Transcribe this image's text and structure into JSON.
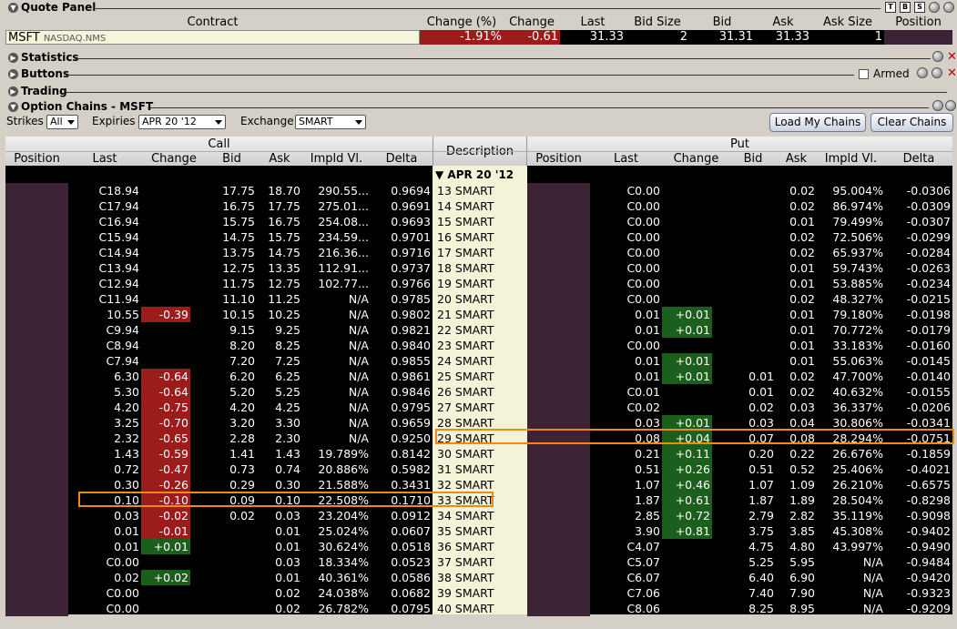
{
  "quote_panel": {
    "title": "Quote Panel",
    "buttons": [
      "T",
      "B",
      "S"
    ],
    "columns": [
      "Contract",
      "Change (%)",
      "Change",
      "Last",
      "Bid Size",
      "Bid",
      "Ask",
      "Ask Size",
      "Position"
    ],
    "row": {
      "symbol": "MSFT",
      "exchange": "NASDAQ.NMS",
      "change_pct": "-1.91%",
      "change": "-0.61",
      "last": "31.33",
      "bid_size": "2",
      "bid": "31.31",
      "ask": "31.33",
      "ask_size": "1",
      "position": ""
    }
  },
  "sections": {
    "statistics": "Statistics",
    "buttons": "Buttons",
    "armed": "Armed",
    "trading": "Trading",
    "option_chains": "Option Chains - MSFT"
  },
  "controls": {
    "strikes_label": "Strikes",
    "strikes_value": "All",
    "expiries_label": "Expiries",
    "expiries_value": "APR 20 '12",
    "exchange_label": "Exchange",
    "exchange_value": "SMART",
    "load_btn": "Load My Chains",
    "clear_btn": "Clear Chains"
  },
  "table": {
    "call_label": "Call",
    "put_label": "Put",
    "description_label": "Description",
    "call_columns": [
      "Position",
      "Last",
      "Change",
      "Bid",
      "Ask",
      "Impld Vl.",
      "Delta"
    ],
    "put_columns": [
      "Position",
      "Last",
      "Change",
      "Bid",
      "Ask",
      "Impld Vl.",
      "Delta"
    ],
    "expiry_group": "APR 20 '12",
    "rows": [
      {
        "desc": "13 SMART",
        "c_last": "C18.94",
        "c_chg": "",
        "c_bid": "17.75",
        "c_ask": "18.70",
        "c_iv": "290.55...",
        "c_delta": "0.9694",
        "p_last": "C0.00",
        "p_chg": "",
        "p_bid": "",
        "p_ask": "0.02",
        "p_iv": "95.004%",
        "p_delta": "-0.0306"
      },
      {
        "desc": "14 SMART",
        "c_last": "C17.94",
        "c_chg": "",
        "c_bid": "16.75",
        "c_ask": "17.75",
        "c_iv": "275.01...",
        "c_delta": "0.9691",
        "p_last": "C0.00",
        "p_chg": "",
        "p_bid": "",
        "p_ask": "0.02",
        "p_iv": "86.974%",
        "p_delta": "-0.0309"
      },
      {
        "desc": "15 SMART",
        "c_last": "C16.94",
        "c_chg": "",
        "c_bid": "15.75",
        "c_ask": "16.75",
        "c_iv": "254.08...",
        "c_delta": "0.9693",
        "p_last": "C0.00",
        "p_chg": "",
        "p_bid": "",
        "p_ask": "0.01",
        "p_iv": "79.499%",
        "p_delta": "-0.0307"
      },
      {
        "desc": "16 SMART",
        "c_last": "C15.94",
        "c_chg": "",
        "c_bid": "14.75",
        "c_ask": "15.75",
        "c_iv": "234.59...",
        "c_delta": "0.9701",
        "p_last": "C0.00",
        "p_chg": "",
        "p_bid": "",
        "p_ask": "0.02",
        "p_iv": "72.506%",
        "p_delta": "-0.0299"
      },
      {
        "desc": "17 SMART",
        "c_last": "C14.94",
        "c_chg": "",
        "c_bid": "13.75",
        "c_ask": "14.75",
        "c_iv": "216.36...",
        "c_delta": "0.9716",
        "p_last": "C0.00",
        "p_chg": "",
        "p_bid": "",
        "p_ask": "0.02",
        "p_iv": "65.937%",
        "p_delta": "-0.0284"
      },
      {
        "desc": "18 SMART",
        "c_last": "C13.94",
        "c_chg": "",
        "c_bid": "12.75",
        "c_ask": "13.35",
        "c_iv": "112.91...",
        "c_delta": "0.9737",
        "p_last": "C0.00",
        "p_chg": "",
        "p_bid": "",
        "p_ask": "0.01",
        "p_iv": "59.743%",
        "p_delta": "-0.0263"
      },
      {
        "desc": "19 SMART",
        "c_last": "C12.94",
        "c_chg": "",
        "c_bid": "11.75",
        "c_ask": "12.75",
        "c_iv": "102.77...",
        "c_delta": "0.9766",
        "p_last": "C0.00",
        "p_chg": "",
        "p_bid": "",
        "p_ask": "0.01",
        "p_iv": "53.885%",
        "p_delta": "-0.0234"
      },
      {
        "desc": "20 SMART",
        "c_last": "C11.94",
        "c_chg": "",
        "c_bid": "11.10",
        "c_ask": "11.25",
        "c_iv": "N/A",
        "c_delta": "0.9785",
        "p_last": "C0.00",
        "p_chg": "",
        "p_bid": "",
        "p_ask": "0.02",
        "p_iv": "48.327%",
        "p_delta": "-0.0215"
      },
      {
        "desc": "21 SMART",
        "c_last": "10.55",
        "c_chg": "-0.39",
        "c_bid": "10.15",
        "c_ask": "10.25",
        "c_iv": "N/A",
        "c_delta": "0.9802",
        "p_last": "0.01",
        "p_chg": "+0.01",
        "p_bid": "",
        "p_ask": "0.01",
        "p_iv": "79.180%",
        "p_delta": "-0.0198"
      },
      {
        "desc": "22 SMART",
        "c_last": "C9.94",
        "c_chg": "",
        "c_bid": "9.15",
        "c_ask": "9.25",
        "c_iv": "N/A",
        "c_delta": "0.9821",
        "p_last": "0.01",
        "p_chg": "+0.01",
        "p_bid": "",
        "p_ask": "0.01",
        "p_iv": "70.772%",
        "p_delta": "-0.0179"
      },
      {
        "desc": "23 SMART",
        "c_last": "C8.94",
        "c_chg": "",
        "c_bid": "8.20",
        "c_ask": "8.25",
        "c_iv": "N/A",
        "c_delta": "0.9840",
        "p_last": "C0.00",
        "p_chg": "",
        "p_bid": "",
        "p_ask": "0.01",
        "p_iv": "33.183%",
        "p_delta": "-0.0160"
      },
      {
        "desc": "24 SMART",
        "c_last": "C7.94",
        "c_chg": "",
        "c_bid": "7.20",
        "c_ask": "7.25",
        "c_iv": "N/A",
        "c_delta": "0.9855",
        "p_last": "0.01",
        "p_chg": "+0.01",
        "p_bid": "",
        "p_ask": "0.01",
        "p_iv": "55.063%",
        "p_delta": "-0.0145"
      },
      {
        "desc": "25 SMART",
        "c_last": "6.30",
        "c_chg": "-0.64",
        "c_bid": "6.20",
        "c_ask": "6.25",
        "c_iv": "N/A",
        "c_delta": "0.9861",
        "p_last": "0.01",
        "p_chg": "+0.01",
        "p_bid": "0.01",
        "p_ask": "0.02",
        "p_iv": "47.700%",
        "p_delta": "-0.0140"
      },
      {
        "desc": "26 SMART",
        "c_last": "5.30",
        "c_chg": "-0.64",
        "c_bid": "5.20",
        "c_ask": "5.25",
        "c_iv": "N/A",
        "c_delta": "0.9846",
        "p_last": "C0.01",
        "p_chg": "",
        "p_bid": "0.01",
        "p_ask": "0.02",
        "p_iv": "40.632%",
        "p_delta": "-0.0155"
      },
      {
        "desc": "27 SMART",
        "c_last": "4.20",
        "c_chg": "-0.75",
        "c_bid": "4.20",
        "c_ask": "4.25",
        "c_iv": "N/A",
        "c_delta": "0.9795",
        "p_last": "C0.02",
        "p_chg": "",
        "p_bid": "0.02",
        "p_ask": "0.03",
        "p_iv": "36.337%",
        "p_delta": "-0.0206"
      },
      {
        "desc": "28 SMART",
        "c_last": "3.25",
        "c_chg": "-0.70",
        "c_bid": "3.20",
        "c_ask": "3.30",
        "c_iv": "N/A",
        "c_delta": "0.9659",
        "p_last": "0.03",
        "p_chg": "+0.01",
        "p_bid": "0.03",
        "p_ask": "0.04",
        "p_iv": "30.806%",
        "p_delta": "-0.0341"
      },
      {
        "desc": "29 SMART",
        "c_last": "2.32",
        "c_chg": "-0.65",
        "c_bid": "2.28",
        "c_ask": "2.30",
        "c_iv": "N/A",
        "c_delta": "0.9250",
        "p_last": "0.08",
        "p_chg": "+0.04",
        "p_bid": "0.07",
        "p_ask": "0.08",
        "p_iv": "28.294%",
        "p_delta": "-0.0751"
      },
      {
        "desc": "30 SMART",
        "c_last": "1.43",
        "c_chg": "-0.59",
        "c_bid": "1.41",
        "c_ask": "1.43",
        "c_iv": "19.789%",
        "c_delta": "0.8142",
        "p_last": "0.21",
        "p_chg": "+0.11",
        "p_bid": "0.20",
        "p_ask": "0.22",
        "p_iv": "26.676%",
        "p_delta": "-0.1859"
      },
      {
        "desc": "31 SMART",
        "c_last": "0.72",
        "c_chg": "-0.47",
        "c_bid": "0.73",
        "c_ask": "0.74",
        "c_iv": "20.886%",
        "c_delta": "0.5982",
        "p_last": "0.51",
        "p_chg": "+0.26",
        "p_bid": "0.51",
        "p_ask": "0.52",
        "p_iv": "25.406%",
        "p_delta": "-0.4021"
      },
      {
        "desc": "32 SMART",
        "c_last": "0.30",
        "c_chg": "-0.26",
        "c_bid": "0.29",
        "c_ask": "0.30",
        "c_iv": "21.588%",
        "c_delta": "0.3431",
        "p_last": "1.07",
        "p_chg": "+0.46",
        "p_bid": "1.07",
        "p_ask": "1.09",
        "p_iv": "26.210%",
        "p_delta": "-0.6575"
      },
      {
        "desc": "33 SMART",
        "c_last": "0.10",
        "c_chg": "-0.10",
        "c_bid": "0.09",
        "c_ask": "0.10",
        "c_iv": "22.508%",
        "c_delta": "0.1710",
        "p_last": "1.87",
        "p_chg": "+0.61",
        "p_bid": "1.87",
        "p_ask": "1.89",
        "p_iv": "28.504%",
        "p_delta": "-0.8298"
      },
      {
        "desc": "34 SMART",
        "c_last": "0.03",
        "c_chg": "-0.02",
        "c_bid": "0.02",
        "c_ask": "0.03",
        "c_iv": "23.204%",
        "c_delta": "0.0912",
        "p_last": "2.85",
        "p_chg": "+0.72",
        "p_bid": "2.79",
        "p_ask": "2.82",
        "p_iv": "35.119%",
        "p_delta": "-0.9098"
      },
      {
        "desc": "35 SMART",
        "c_last": "0.01",
        "c_chg": "-0.01",
        "c_bid": "",
        "c_ask": "0.01",
        "c_iv": "25.024%",
        "c_delta": "0.0607",
        "p_last": "3.90",
        "p_chg": "+0.81",
        "p_bid": "3.75",
        "p_ask": "3.85",
        "p_iv": "45.308%",
        "p_delta": "-0.9402"
      },
      {
        "desc": "36 SMART",
        "c_last": "0.01",
        "c_chg": "+0.01",
        "c_bid": "",
        "c_ask": "0.01",
        "c_iv": "30.624%",
        "c_delta": "0.0518",
        "p_last": "C4.07",
        "p_chg": "",
        "p_bid": "4.75",
        "p_ask": "4.80",
        "p_iv": "43.997%",
        "p_delta": "-0.9490"
      },
      {
        "desc": "37 SMART",
        "c_last": "C0.00",
        "c_chg": "",
        "c_bid": "",
        "c_ask": "0.03",
        "c_iv": "18.334%",
        "c_delta": "0.0523",
        "p_last": "C5.07",
        "p_chg": "",
        "p_bid": "5.25",
        "p_ask": "5.95",
        "p_iv": "N/A",
        "p_delta": "-0.9484"
      },
      {
        "desc": "38 SMART",
        "c_last": "0.02",
        "c_chg": "+0.02",
        "c_bid": "",
        "c_ask": "0.01",
        "c_iv": "40.361%",
        "c_delta": "0.0586",
        "p_last": "C6.07",
        "p_chg": "",
        "p_bid": "6.40",
        "p_ask": "6.90",
        "p_iv": "N/A",
        "p_delta": "-0.9420"
      },
      {
        "desc": "39 SMART",
        "c_last": "C0.00",
        "c_chg": "",
        "c_bid": "",
        "c_ask": "0.02",
        "c_iv": "24.038%",
        "c_delta": "0.0682",
        "p_last": "C7.06",
        "p_chg": "",
        "p_bid": "7.40",
        "p_ask": "7.90",
        "p_iv": "N/A",
        "p_delta": "-0.9323"
      },
      {
        "desc": "40 SMART",
        "c_last": "C0.00",
        "c_chg": "",
        "c_bid": "",
        "c_ask": "0.02",
        "c_iv": "26.782%",
        "c_delta": "0.0795",
        "p_last": "C8.06",
        "p_chg": "",
        "p_bid": "8.25",
        "p_ask": "8.95",
        "p_iv": "N/A",
        "p_delta": "-0.9209"
      }
    ]
  },
  "colors": {
    "negative": "#9c1b1b",
    "positive": "#1c5e1c",
    "position_cell": "#3c2436",
    "highlight": "#f08a10"
  }
}
